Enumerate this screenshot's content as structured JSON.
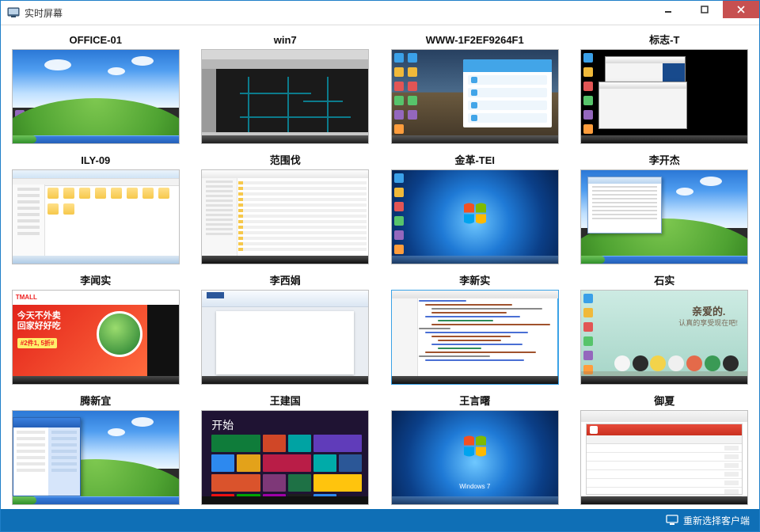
{
  "window": {
    "title": "实时屏幕"
  },
  "footer": {
    "reselect_label": "重新选择客户端"
  },
  "clients": [
    {
      "name": "OFFICE-01",
      "kind": "xp-bliss",
      "selected": false
    },
    {
      "name": "win7",
      "kind": "cad",
      "selected": false
    },
    {
      "name": "WWW-1F2EF9264F1",
      "kind": "www",
      "selected": false
    },
    {
      "name": "标志-T",
      "kind": "biaozhi",
      "selected": false
    },
    {
      "name": "ILY-09",
      "kind": "explorer",
      "selected": false
    },
    {
      "name": "范围伐",
      "kind": "listview",
      "selected": false
    },
    {
      "name": "金革-TEI",
      "kind": "win7",
      "selected": false
    },
    {
      "name": "李开杰",
      "kind": "likaijie",
      "selected": false
    },
    {
      "name": "李闻实",
      "kind": "tmall",
      "selected": false
    },
    {
      "name": "李西娟",
      "kind": "word",
      "selected": false
    },
    {
      "name": "李新实",
      "kind": "ide",
      "selected": true
    },
    {
      "name": "石实",
      "kind": "cute",
      "selected": false
    },
    {
      "name": "腾新宜",
      "kind": "tengxin",
      "selected": false
    },
    {
      "name": "王建国",
      "kind": "win8",
      "selected": false
    },
    {
      "name": "王言曙",
      "kind": "win7text",
      "selected": false
    },
    {
      "name": "御夏",
      "kind": "xls",
      "selected": false
    }
  ],
  "strings": {
    "tmall_logo": "TMALL",
    "tmall_line1": "今天不外卖",
    "tmall_line2": "回家好好吃",
    "tmall_tag": "#2件1, 5折#",
    "win8_header": "开始",
    "win7_text": "Windows 7",
    "cute_line1": "亲爱的.",
    "cute_line2": "认真的享受现在吧!"
  },
  "palettes": {
    "icon_colors": [
      "#3aa0e8",
      "#f0b93a",
      "#e25555",
      "#57c46b",
      "#9467bd",
      "#ff9d3c",
      "#4bb3c1"
    ],
    "win8_tiles": [
      "#0f7c3a",
      "#d04727",
      "#00a3a3",
      "#603cba",
      "#2d89ef",
      "#e3a21a",
      "#b91d47",
      "#00aba9",
      "#2b5797",
      "#da532c",
      "#7e3878",
      "#1e7145",
      "#ffc40d",
      "#ee1111",
      "#00a300",
      "#9f00a7",
      "#1d1d1d",
      "#2d89ef"
    ],
    "cute_chars": [
      "#f5f5f5",
      "#2b2b2b",
      "#f3d34a",
      "#f0f0f0",
      "#e46a4a",
      "#3a9a55",
      "#2b2b2b"
    ],
    "code_widths": [
      60,
      110,
      140,
      95,
      120,
      70,
      150,
      40,
      130,
      100,
      80,
      115,
      55,
      140,
      90,
      125
    ],
    "code_colors": [
      "#4a6fd4",
      "#a0522d",
      "#888",
      "#a0522d",
      "#4a6fd4",
      "#2e8b57",
      "#a0522d",
      "#888",
      "#4a6fd4",
      "#a0522d",
      "#a0522d",
      "#4a6fd4",
      "#2e8b57",
      "#a0522d",
      "#888",
      "#4a6fd4"
    ],
    "code_indent": [
      0,
      8,
      16,
      16,
      8,
      24,
      16,
      0,
      8,
      16,
      24,
      16,
      24,
      8,
      0,
      8
    ]
  }
}
